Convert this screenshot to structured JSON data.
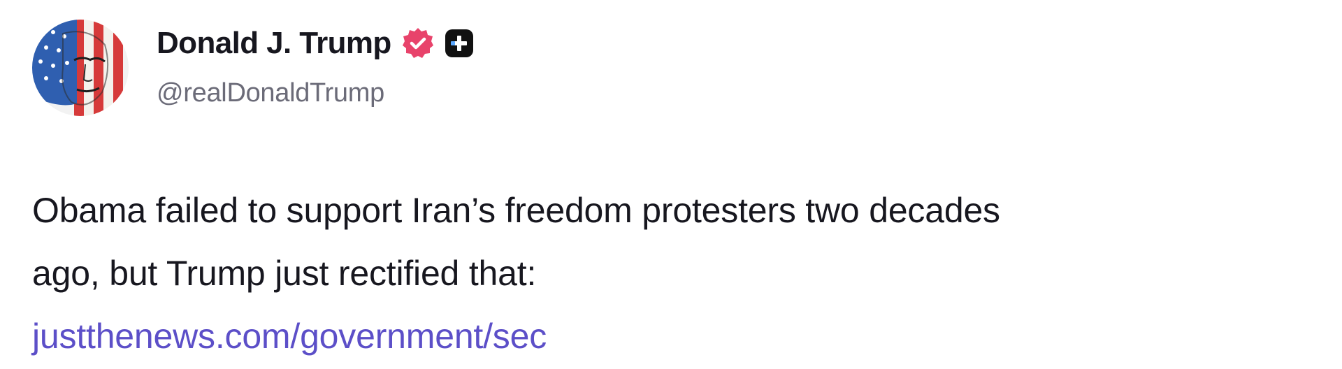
{
  "post": {
    "author": {
      "display_name": "Donald J. Trump",
      "handle": "@realDonaldTrump",
      "avatar_icon": "flag-portrait-avatar",
      "verified_icon": "verified-badge-icon",
      "verified_color": "#e8436b",
      "plus_icon": "plus-badge-icon",
      "plus_color": "#111111"
    },
    "text_line_1": "Obama failed to support Iran’s freedom protesters two decades",
    "text_line_2": "ago, but Trump just rectified that:",
    "link_text": "justthenews.com/government/sec",
    "link_color": "#5c4fc8"
  }
}
